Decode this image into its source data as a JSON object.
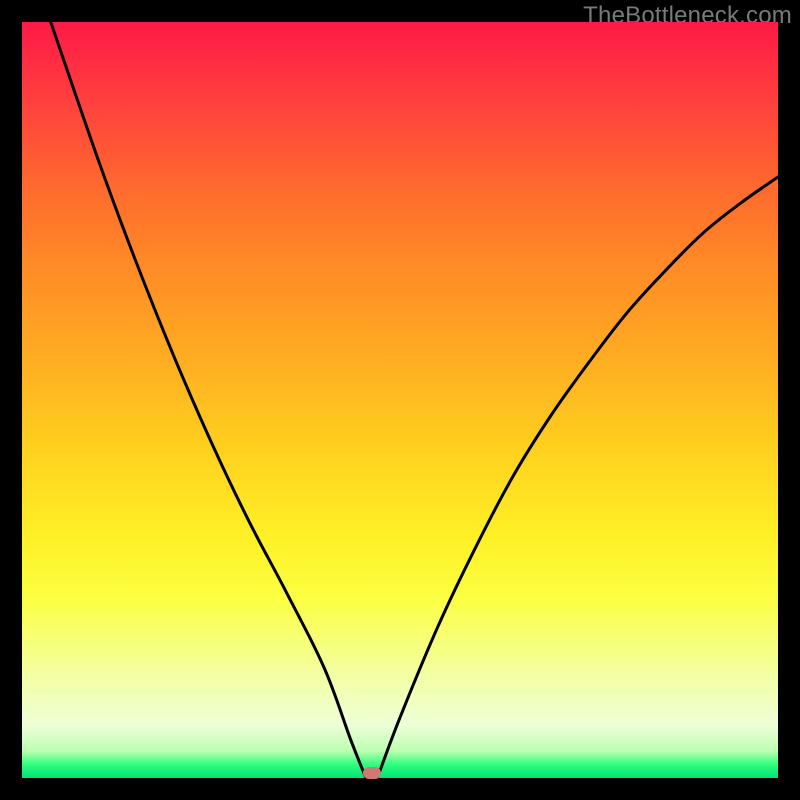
{
  "watermark": "TheBottleneck.com",
  "colors": {
    "frame": "#000000",
    "curve": "#000000",
    "marker": "#cb7b74",
    "gradient_top": "#ff1a46",
    "gradient_bottom": "#00e277"
  },
  "chart_data": {
    "type": "line",
    "title": "",
    "xlabel": "",
    "ylabel": "",
    "xlim": [
      0,
      100
    ],
    "ylim": [
      0,
      100
    ],
    "note": "Axes are unlabeled; values estimated from pixel positions on a 0–100 normalized scale. y=0 is the bottom (green) edge, y=100 is the top (red) edge.",
    "series": [
      {
        "name": "left-branch",
        "x": [
          3.8,
          10,
          15,
          20,
          25,
          30,
          35,
          40,
          43.5,
          45.5
        ],
        "y": [
          100,
          82,
          68.5,
          56,
          44.5,
          34,
          24.5,
          14.5,
          5,
          0
        ]
      },
      {
        "name": "right-branch",
        "x": [
          47,
          50,
          55,
          60,
          65,
          70,
          75,
          80,
          85,
          90,
          95,
          100
        ],
        "y": [
          0,
          8,
          20,
          30.5,
          40,
          48,
          55,
          61.5,
          67,
          72,
          76,
          79.5
        ]
      }
    ],
    "marker": {
      "x": 46.3,
      "y": 0.6
    },
    "grid": false,
    "legend": false
  }
}
